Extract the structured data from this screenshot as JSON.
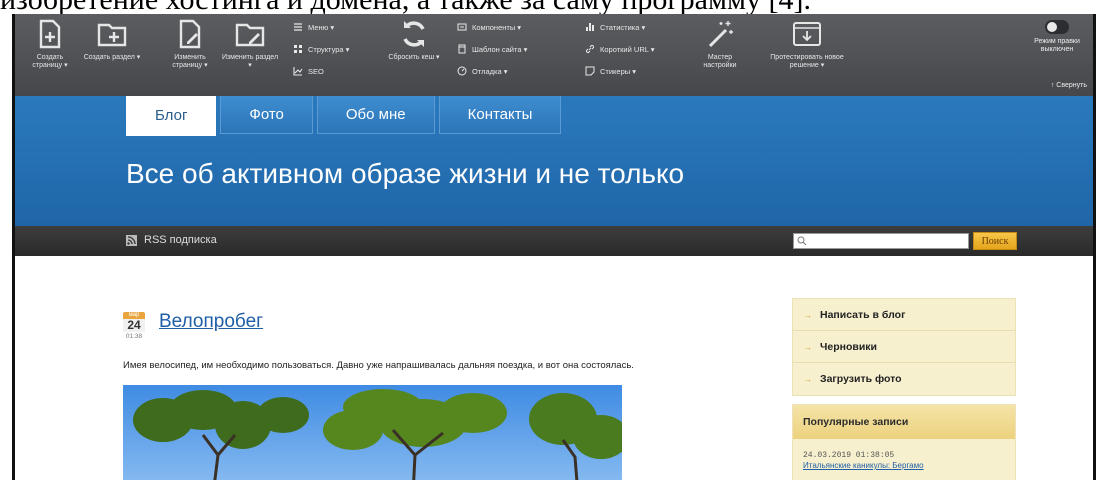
{
  "document_caption": "изобретение хостинга и домена, а также за саму программу [4].",
  "admin_panel": {
    "buttons": [
      {
        "label": "Создать страницу ▾",
        "icon": "create-page-icon"
      },
      {
        "label": "Создать раздел ▾",
        "icon": "create-section-icon"
      },
      {
        "label": "Изменить страницу ▾",
        "icon": "edit-page-icon"
      },
      {
        "label": "Изменить раздел ▾",
        "icon": "edit-section-icon"
      },
      {
        "label": "Сбросить кеш ▾",
        "icon": "refresh-icon"
      },
      {
        "label": "Мастер настройки",
        "icon": "magic-wand-icon"
      },
      {
        "label": "Протестировать новое решение ▾",
        "icon": "download-icon"
      }
    ],
    "menu_group_1": [
      "Меню ▾",
      "Структура ▾",
      "SEO"
    ],
    "menu_group_2": [
      "Компоненты ▾",
      "Шаблон сайта ▾",
      "Отладка ▾"
    ],
    "menu_group_3": [
      "Статистика ▾",
      "Короткий URL ▾",
      "Стикеры ▾"
    ],
    "edit_mode": "Режим правки выключен",
    "collapse": "↑ Свернуть"
  },
  "site": {
    "tabs": [
      "Блог",
      "Фото",
      "Обо мне",
      "Контакты"
    ],
    "active_tab": "Блог",
    "title": "Все об активном образе жизни и  не только"
  },
  "rss_bar": {
    "rss_label": "RSS подписка",
    "search_placeholder": "",
    "search_button": "Поиск"
  },
  "post": {
    "month": "мар",
    "day": "24",
    "time": "01:38",
    "title": "Велопробег",
    "text": "Имея велосипед, им необходимо пользоваться. Давно уже напрашивалась дальняя поездка, и вот она состоялась."
  },
  "sidebar": {
    "menu": [
      "Написать в блог",
      "Черновики",
      "Загрузить фото"
    ],
    "popular_title": "Популярные записи",
    "popular_date": "24.03.2019 01:38:05",
    "popular_link": "Итальянские каникулы: Бергамо"
  },
  "colors": {
    "header_blue": "#2b79bd",
    "admin_gray": "#505256",
    "accent_orange": "#e5a51c",
    "sidebar_bg": "#f7f0cf",
    "link_blue": "#1f5fa8"
  }
}
